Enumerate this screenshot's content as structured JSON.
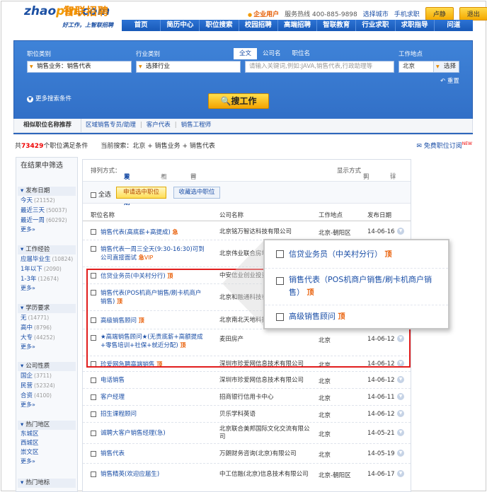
{
  "header": {
    "brand_latin_a": "zhao",
    "brand_latin_b": "pin",
    "brand_latin_c": ".com",
    "brand_cn": "智联招聘",
    "slogan": "好工作，上智联招聘",
    "enterprise": "企业用户",
    "hotline": "服务热线 400-885-9898",
    "select_city": "选择城市",
    "mobile": "手机求职",
    "user": "卢静",
    "logout": "退出"
  },
  "nav": [
    "首页",
    "简历中心",
    "职位搜索",
    "校园招聘",
    "高端招聘",
    "智联教育",
    "行业求职",
    "求职指导",
    "问道"
  ],
  "search": {
    "job_type_label": "职位类别",
    "job_type_value": "销售业务：销售代表",
    "industry_label": "行业类别",
    "industry_value": "选择行业",
    "tabs": [
      "全文",
      "公司名",
      "职位名"
    ],
    "keyword_placeholder": "请输入关键词,例如:JAVA,销售代表,行政助理等",
    "location_label": "工作地点",
    "location_value": "北京",
    "location_pick": "选择",
    "reset": "重置",
    "more": "更多搜索条件",
    "search_button": "搜工作"
  },
  "related": {
    "heading": "相似职位名称推荐",
    "items": [
      "区域销售专员/助理",
      "客户代表",
      "销售工程师"
    ]
  },
  "summary": {
    "prefix": "共",
    "count": "73429",
    "suffix": "个职位满足条件",
    "current": "当前搜索：北京 + 销售业务 + 销售代表",
    "subscribe": "免费职位订阅",
    "new_badge": "NEW"
  },
  "sidebar": {
    "title": "在结果中筛选",
    "groups": [
      {
        "name": "发布日期",
        "items": [
          {
            "label": "今天",
            "n": "(21152)"
          },
          {
            "label": "最近三天",
            "n": "(50037)"
          },
          {
            "label": "最近一周",
            "n": "(60292)"
          }
        ],
        "more": "更多»"
      },
      {
        "name": "工作经验",
        "items": [
          {
            "label": "应届毕业生",
            "n": "(10824)"
          },
          {
            "label": "1年以下",
            "n": "(2090)"
          },
          {
            "label": "1-3年",
            "n": "(12674)"
          }
        ],
        "more": "更多»"
      },
      {
        "name": "学历要求",
        "items": [
          {
            "label": "无",
            "n": "(14771)"
          },
          {
            "label": "高中",
            "n": "(8796)"
          },
          {
            "label": "大专",
            "n": "(44252)"
          }
        ],
        "more": "更多»"
      },
      {
        "name": "公司性质",
        "items": [
          {
            "label": "国企",
            "n": "(3711)"
          },
          {
            "label": "民营",
            "n": "(52324)"
          },
          {
            "label": "合资",
            "n": "(4100)"
          }
        ],
        "more": "更多»"
      },
      {
        "name": "热门地区",
        "items": [
          {
            "label": "东城区",
            "n": ""
          },
          {
            "label": "西城区",
            "n": ""
          },
          {
            "label": "崇文区",
            "n": ""
          }
        ],
        "more": "更多»"
      },
      {
        "name": "热门地标",
        "items": [],
        "more": ""
      }
    ]
  },
  "list": {
    "sort_label": "排列方式：",
    "sort_date": "发布日期",
    "sort_relevance": "相关度",
    "sort_first": "首发日",
    "display_label": "显示方式",
    "display_list": "列表",
    "display_detail": "详细",
    "select_all": "全选",
    "apply_button": "申请选中职位",
    "fav_button": "收藏选中职位",
    "col_title": "职位名称",
    "col_company": "公司名称",
    "col_city": "工作地点",
    "col_date": "发布日期",
    "rows": [
      {
        "title": "销售代表(高底薪+高提成)",
        "tag": "急",
        "company": "北京铭万智达科技有限公司",
        "city": "北京-朝阳区",
        "date": "14-06-16"
      },
      {
        "title": "销售代表一周三全天(9:30-16:30)可到公司直接面试",
        "tag": "急",
        "vip": "VIP",
        "company": "北京伟业联合房地产...",
        "city": "",
        "date": ""
      },
      {
        "title": "信贷业务员(中关村分行)",
        "tag": "顶",
        "company": "中安信业创业投资...",
        "city": "",
        "date": ""
      },
      {
        "title": "销售代表(POS机商户销售/刷卡机商户销售)",
        "tag": "顶",
        "company": "北京和融通科技有限...",
        "city": "",
        "date": ""
      },
      {
        "title": "高级销售顾问",
        "tag": "顶",
        "company": "北京南北天地科技...",
        "city": "",
        "date": ""
      },
      {
        "title": "★高端销售顾问★(无责底薪+高额提成+零售培训+社保+就近分配)",
        "tag": "顶",
        "company": "麦田房产",
        "city": "北京",
        "date": "14-06-12"
      },
      {
        "title": "珍爱网急聘高端销售",
        "tag": "顶",
        "company": "深圳市珍爱网信息技术有限公司",
        "city": "北京",
        "date": "14-06-12"
      },
      {
        "title": "电话销售",
        "tag": "",
        "company": "深圳市珍爱网信息技术有限公司",
        "city": "北京",
        "date": "14-06-12"
      },
      {
        "title": "客户经理",
        "tag": "",
        "company": "招商银行信用卡中心",
        "city": "北京",
        "date": "14-06-11"
      },
      {
        "title": "招生课程顾问",
        "tag": "",
        "company": "贝乐学科英语",
        "city": "北京",
        "date": "14-06-12"
      },
      {
        "title": "诚聘大客户销售经理(急)",
        "tag": "",
        "company": "北京联合美邦国际文化交流有限公司",
        "city": "北京",
        "date": "14-05-21"
      },
      {
        "title": "销售代表",
        "tag": "",
        "company": "万朗财务咨询(北京)有限公司",
        "city": "北京",
        "date": "14-05-19"
      },
      {
        "title": "销售精英(欢迎应届生)",
        "tag": "",
        "company": "中工信融(北京)信息技术有限公司",
        "city": "北京-朝阳区",
        "date": "14-06-17"
      }
    ]
  },
  "zoom": {
    "rows": [
      {
        "title": "信贷业务员（中关村分行）",
        "tag": "顶"
      },
      {
        "title": "销售代表（POS机商户销售/刷卡机商户销售）",
        "tag": "顶"
      },
      {
        "title": "高级销售顾问",
        "tag": "顶"
      }
    ]
  },
  "colors": {
    "primary": "#2f6cc4",
    "accent": "#f3a300",
    "highlight": "#e11d1d"
  }
}
